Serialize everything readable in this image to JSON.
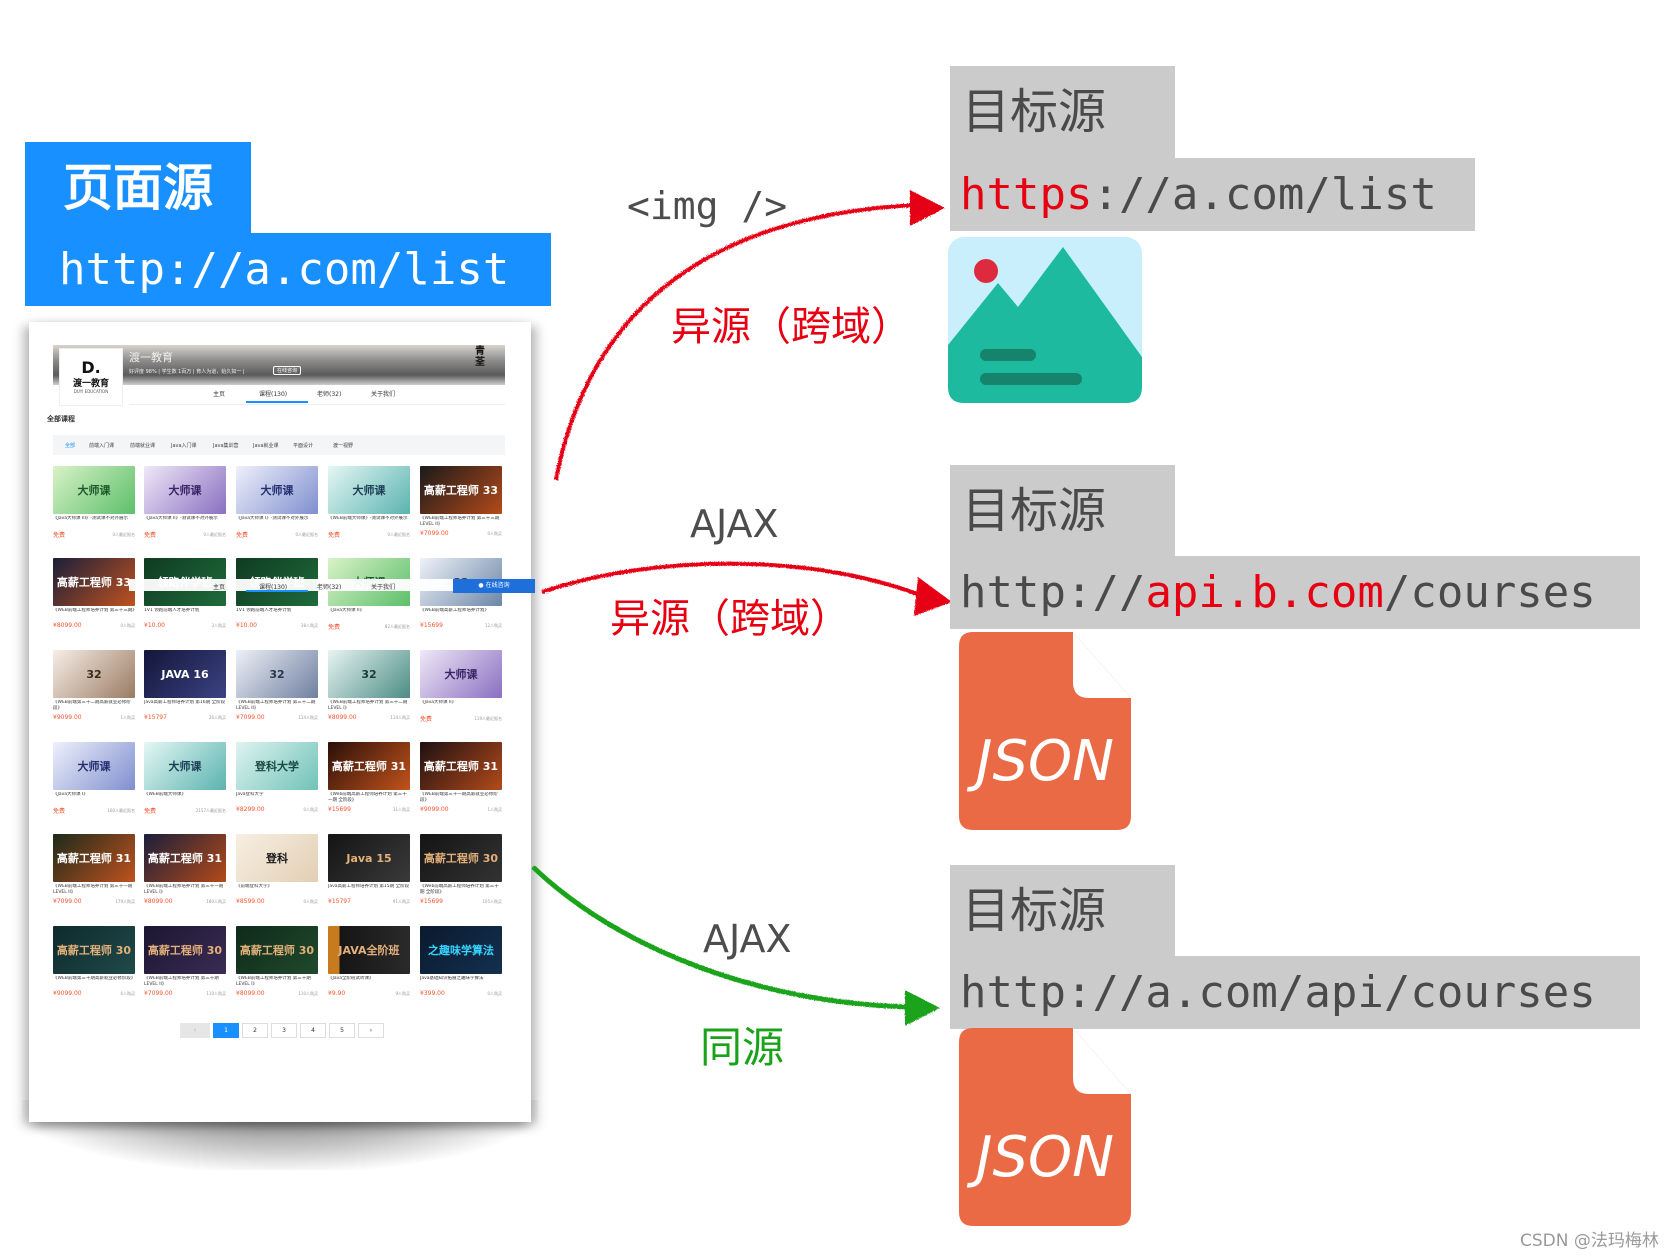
{
  "source": {
    "title": "页面源",
    "url": "http://a.com/list",
    "color": "#1890ff"
  },
  "screenshot": {
    "org": {
      "logo_letter": "D.",
      "logo_cn": "渡一教育",
      "logo_en": "DUYI EDUCATION",
      "name": "渡一教育",
      "stats": "好评度 98%  |  学生数 1百万  |  育人为道，始久如一  |",
      "consult": "在线咨询",
      "right_mark": "青荃"
    },
    "nav": [
      "主页",
      "课程(130)",
      "老师(32)",
      "关于我们"
    ],
    "nav_active": 1,
    "section_title": "全部课程",
    "categories": [
      "全部",
      "前端入门课",
      "前端就业课",
      "Java入门课",
      "Java集训营",
      "Java就业课",
      "平面设计",
      "渡一视野"
    ],
    "category_active": 0,
    "floating": {
      "consult": "在线咨询"
    },
    "courses": [
      {
        "banner": "大师课",
        "caption": "《Java大师课 III》-测试课不对外展示",
        "price": "免费",
        "buyers": "0人最近报名",
        "bg": "linear-gradient(135deg,#d9f2c7,#5cbf6a)",
        "fg": "#1e5a2c"
      },
      {
        "banner": "大师课",
        "caption": "《Java大师课 II》-测试课不对外展示",
        "price": "免费",
        "buyers": "0人最近报名",
        "bg": "linear-gradient(135deg,#efe8f7,#8a6fc1)",
        "fg": "#3a2466"
      },
      {
        "banner": "大师课",
        "caption": "《Java大师课 I》-测试课不对外展示",
        "price": "免费",
        "buyers": "0人最近报名",
        "bg": "linear-gradient(135deg,#eef0fb,#7f8fcf)",
        "fg": "#263070"
      },
      {
        "banner": "大师课",
        "caption": "《WEB前端大师课》-测试课不对外展示",
        "price": "免费",
        "buyers": "0人最近报名",
        "bg": "linear-gradient(135deg,#e4f7f4,#5bb3b0)",
        "fg": "#1d3f55"
      },
      {
        "banner": "高薪工程师 33",
        "caption": "《WEB前端工程师培养计划 第三十三期 LEVEL II》",
        "price": "¥7099.00",
        "buyers": "0人购买",
        "bg": "linear-gradient(135deg,#1a1a1a,#b34a1a)",
        "fg": "#ffffff"
      },
      {
        "banner": "高薪工程师 33",
        "caption": "《WEB前端工程师培养计划 第三十三期》",
        "price": "¥8099.00",
        "buyers": "0人购买",
        "bg": "linear-gradient(135deg,#1a1f3a,#c0521f)",
        "fg": "#ffffff"
      },
      {
        "banner": "领跑伴学班",
        "caption": "1V1 领跑前端人才培养计划",
        "price": "¥10.00",
        "buyers": "3人购买",
        "bg": "linear-gradient(135deg,#0f3b22,#1f6b3a)",
        "fg": "#ffffff"
      },
      {
        "banner": "领跑伴学班",
        "caption": "1V1 领跑前端人才培养计划",
        "price": "¥10.00",
        "buyers": "38人购买",
        "bg": "linear-gradient(135deg,#0f3b22,#1f6b3a)",
        "fg": "#ffffff"
      },
      {
        "banner": "大师课",
        "caption": "《Java大师课 II》",
        "price": "免费",
        "buyers": "82人最近报名",
        "bg": "linear-gradient(135deg,#d9f2c7,#5cbf6a)",
        "fg": "#1e5a2c"
      },
      {
        "banner": "32",
        "caption": "《WEB前端高薪工程师培养计划》",
        "price": "¥15699",
        "buyers": "12人购买",
        "bg": "linear-gradient(135deg,#eef2f7,#6b86a8)",
        "fg": "#2b3c55"
      },
      {
        "banner": "32",
        "caption": "《WEB前端第三十二期高薪就业必修阶段》",
        "price": "¥9099.00",
        "buyers": "1人购买",
        "bg": "linear-gradient(135deg,#f6eee6,#9a7b63)",
        "fg": "#3a2a1a"
      },
      {
        "banner": "JAVA 16",
        "caption": "Java高薪工程师培养计划 第16期 全阶段",
        "price": "¥15797",
        "buyers": "26人购买",
        "bg": "linear-gradient(135deg,#13163a,#3b4382)",
        "fg": "#ffffff"
      },
      {
        "banner": "32",
        "caption": "《WEB前端工程师培养计划 第三十二期 LEVEL II》",
        "price": "¥7099.00",
        "buyers": "114人购买",
        "bg": "linear-gradient(135deg,#eef0f6,#6e7fa0)",
        "fg": "#2b3450"
      },
      {
        "banner": "32",
        "caption": "《WEB前端工程师培养计划 第三十二期 LEVEL I》",
        "price": "¥8099.00",
        "buyers": "114人购买",
        "bg": "linear-gradient(135deg,#e7f4f1,#4c8c85)",
        "fg": "#1f3b38"
      },
      {
        "banner": "大师课",
        "caption": "《Java大师课 II》",
        "price": "免费",
        "buyers": "119人最近报名",
        "bg": "linear-gradient(135deg,#efe8f7,#8a6fc1)",
        "fg": "#3a2466"
      },
      {
        "banner": "大师课",
        "caption": "《Java大师课 I》",
        "price": "免费",
        "buyers": "160人最近报名",
        "bg": "linear-gradient(135deg,#eef0fb,#7f8fcf)",
        "fg": "#263070"
      },
      {
        "banner": "大师课",
        "caption": "《WEB前端大师课》",
        "price": "免费",
        "buyers": "2157人最近报名",
        "bg": "linear-gradient(135deg,#e4f7f4,#5bb3b0)",
        "fg": "#1d3f55"
      },
      {
        "banner": "登科大学",
        "caption": "Java登科大学",
        "price": "¥8299.00",
        "buyers": "0人购买",
        "bg": "linear-gradient(135deg,#dff3f1,#6fc2b8)",
        "fg": "#1b4a45"
      },
      {
        "banner": "高薪工程师 31",
        "caption": "《Web前端高薪工程师培养计划 第三十一期 全阶段》",
        "price": "¥15699",
        "buyers": "31人购买",
        "bg": "linear-gradient(135deg,#2a0f08,#c2531c)",
        "fg": "#ffffff"
      },
      {
        "banner": "高薪工程师 31",
        "caption": "《WEB前端第三十一期高薪就业必修阶段》",
        "price": "¥9099.00",
        "buyers": "1人购买",
        "bg": "linear-gradient(135deg,#1e1012,#b34a1a)",
        "fg": "#ffffff"
      },
      {
        "banner": "高薪工程师 31",
        "caption": "《WEB前端工程师培养计划 第三十一期 LEVEL II》",
        "price": "¥7099.00",
        "buyers": "179人购买",
        "bg": "linear-gradient(135deg,#1c2a1a,#c0521f)",
        "fg": "#ffffff"
      },
      {
        "banner": "高薪工程师 31",
        "caption": "《WEB前端工程师培养计划 第三十一期 LEVEL I》",
        "price": "¥8099.00",
        "buyers": "180人购买",
        "bg": "linear-gradient(135deg,#1a1f3a,#b34a1a)",
        "fg": "#ffffff"
      },
      {
        "banner": "登科",
        "caption": "《前端登科大学》",
        "price": "¥8599.00",
        "buyers": "0人购买",
        "bg": "linear-gradient(135deg,#f7efe3,#e2cfb3)",
        "fg": "#1a1a1a"
      },
      {
        "banner": "Java 15",
        "caption": "Java高薪工程师培养计划 第15期 全阶段",
        "price": "¥15797",
        "buyers": "91人购买",
        "bg": "linear-gradient(135deg,#141414,#3a3a3a)",
        "fg": "#e3b07a"
      },
      {
        "banner": "高薪工程师 30",
        "caption": "《Web前端高薪工程师培养计划 第三十期 全阶段》",
        "price": "¥15699",
        "buyers": "105人购买",
        "bg": "linear-gradient(135deg,#141414,#333333)",
        "fg": "#e3b07a"
      },
      {
        "banner": "高薪工程师 30",
        "caption": "《WEB前端第三十期高薪就业必修阶段》",
        "price": "¥9099.00",
        "buyers": "6人购买",
        "bg": "linear-gradient(135deg,#0f2a2c,#1f4a4a)",
        "fg": "#e3b07a"
      },
      {
        "banner": "高薪工程师 30",
        "caption": "《WEB前端工程师培养计划 第三十期 LEVEL II》",
        "price": "¥7099.00",
        "buyers": "110人购买",
        "bg": "linear-gradient(135deg,#1c1630,#3a2c55)",
        "fg": "#e3b07a"
      },
      {
        "banner": "高薪工程师 30",
        "caption": "《WEB前端工程师培养计划 第三十期 LEVEL I》",
        "price": "¥8099.00",
        "buyers": "110人购买",
        "bg": "linear-gradient(135deg,#0f2a1a,#1f4a2c)",
        "fg": "#e3b07a"
      },
      {
        "banner": "JAVA全阶班",
        "caption": "《Java全阶班试听课》",
        "price": "¥9.90",
        "buyers": "9人购买",
        "bg": "linear-gradient(90deg,#c87a1e 0%,#c87a1e 14%,#151515 14%,#2a2a2a 100%)",
        "fg": "#e3b07a"
      },
      {
        "banner": "之趣味学算法",
        "caption": "Java基础知识拓展之趣味学算法",
        "price": "¥399.00",
        "buyers": "0人购买",
        "bg": "linear-gradient(135deg,#0b1a2e,#13304f)",
        "fg": "#38d4ff"
      }
    ],
    "pagination": {
      "prev": "‹",
      "pages": [
        "1",
        "2",
        "3",
        "4",
        "5"
      ],
      "active": "1",
      "next": "›"
    }
  },
  "arrows": [
    {
      "id": "img",
      "method": "<img />",
      "relation": "异源（跨域）",
      "color": "#e60012"
    },
    {
      "id": "ajax-cross",
      "method": "AJAX",
      "relation": "异源（跨域）",
      "color": "#e60012"
    },
    {
      "id": "ajax-same",
      "method": "AJAX",
      "relation": "同源",
      "color": "#1aa31a"
    }
  ],
  "targets": [
    {
      "title": "目标源",
      "url_parts": [
        {
          "text": "https",
          "highlight": true
        },
        {
          "text": "://a.com/list",
          "highlight": false
        }
      ],
      "resource": "image-icon"
    },
    {
      "title": "目标源",
      "url_parts": [
        {
          "text": "http://",
          "highlight": false
        },
        {
          "text": "api.b.com",
          "highlight": true
        },
        {
          "text": "/courses",
          "highlight": false
        }
      ],
      "resource": "json-file-icon",
      "resource_label": "JSON"
    },
    {
      "title": "目标源",
      "url_parts": [
        {
          "text": "http://a.com/api/courses",
          "highlight": false
        }
      ],
      "resource": "json-file-icon",
      "resource_label": "JSON"
    }
  ],
  "colors": {
    "target_box": "#cbcbcb",
    "text_gray": "#4a4a4a",
    "highlight_red": "#e60012",
    "json_orange": "#ea6a45",
    "image_sky": "#c9effc",
    "image_mountain": "#1dba9f",
    "image_sun": "#de2a3e"
  },
  "watermark": "CSDN @法玛梅林"
}
